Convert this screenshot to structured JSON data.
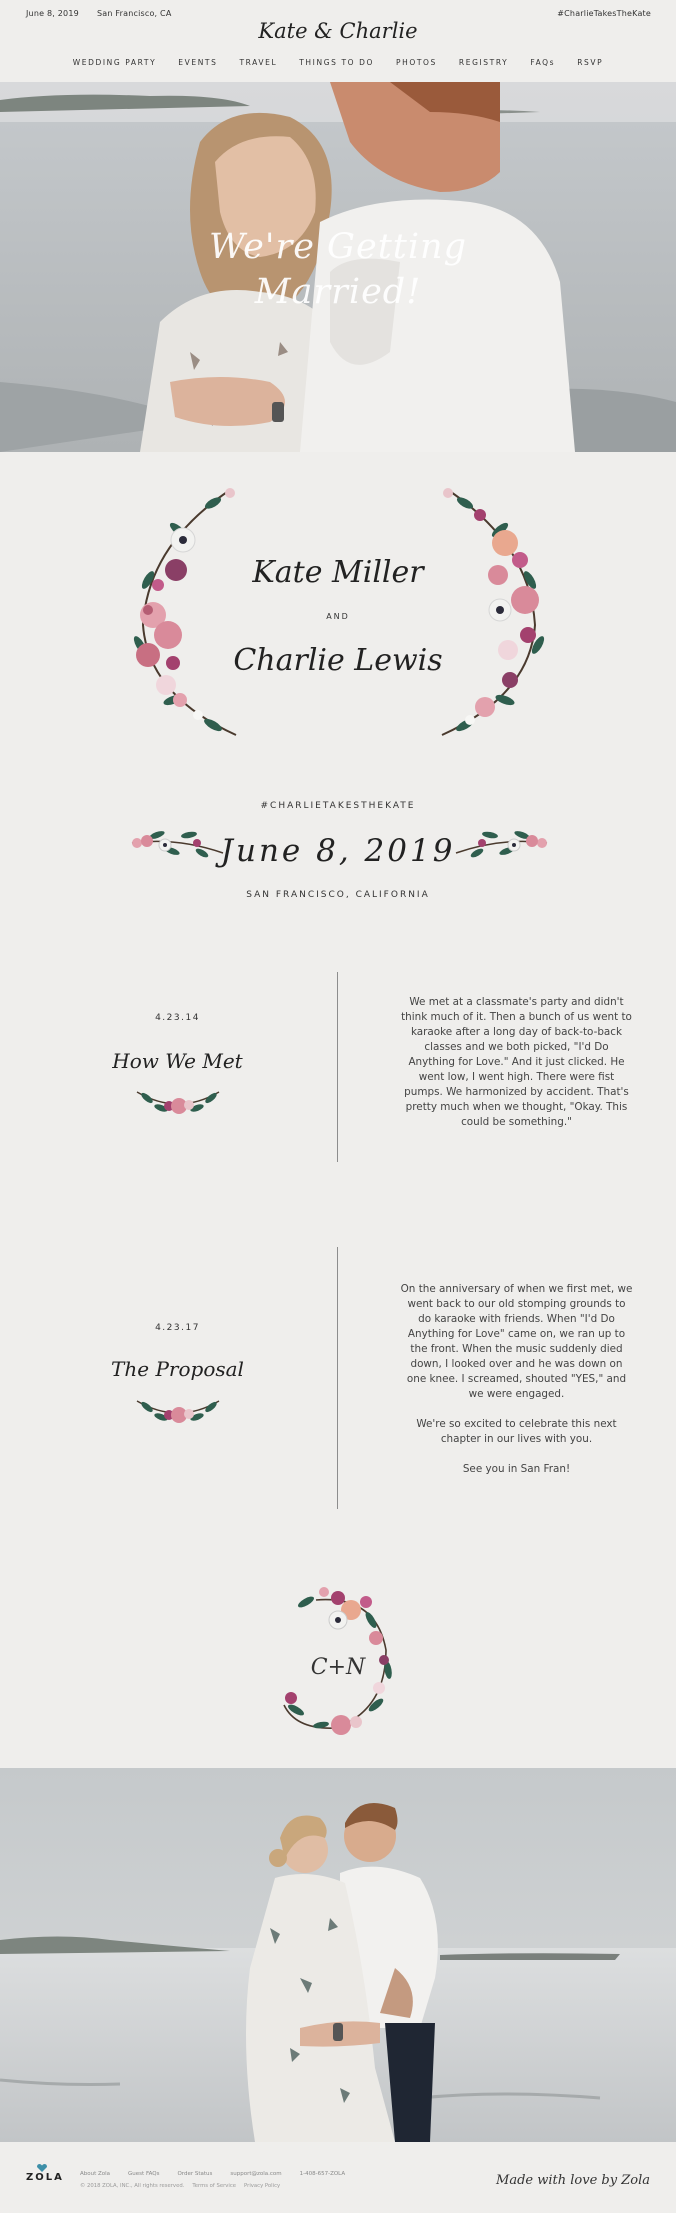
{
  "header": {
    "date": "June 8, 2019",
    "location": "San Francisco, CA",
    "title": "Kate & Charlie",
    "hashtag": "#CharlieTakesTheKate",
    "nav": [
      "WEDDING PARTY",
      "EVENTS",
      "TRAVEL",
      "THINGS TO DO",
      "PHOTOS",
      "REGISTRY",
      "FAQs",
      "RSVP"
    ]
  },
  "hero": {
    "line1": "We're Getting",
    "line2": "Married!"
  },
  "couple": {
    "name1": "Kate Miller",
    "and": "AND",
    "name2": "Charlie Lewis"
  },
  "event": {
    "hashtag": "#CHARLIETAKESTHEKATE",
    "date": "June 8, 2019",
    "city": "SAN FRANCISCO, CALIFORNIA"
  },
  "stories": [
    {
      "date": "4.23.14",
      "title": "How We Met",
      "paragraphs": [
        "We met at a classmate's party and didn't think much of it. Then a bunch of us went to karaoke after a long day of back-to-back classes and we both picked, \"I'd Do Anything for Love.\" And it just clicked. He went low, I went high. There were fist pumps. We harmonized by accident. That's pretty much when we thought, \"Okay. This could be something.\""
      ]
    },
    {
      "date": "4.23.17",
      "title": "The Proposal",
      "paragraphs": [
        "On the anniversary of when we first met, we went back to our old stomping grounds to do karaoke with friends. When \"I'd Do Anything for Love\" came on, we ran up to the front. When the music suddenly died down, I looked over and he was down on one knee. I screamed, shouted \"YES,\" and we were engaged.",
        "We're so excited to celebrate this next chapter in our lives with you.",
        "See you in San Fran!"
      ]
    }
  ],
  "monogram": "C+N",
  "footer": {
    "logo": "ZOLA",
    "links": [
      "About Zola",
      "Guest FAQs",
      "Order Status",
      "support@zola.com",
      "1-408-657-ZOLA"
    ],
    "legal": [
      "© 2018 ZOLA, INC., All rights reserved.",
      "Terms of Service",
      "Privacy Policy"
    ],
    "made_with": "Made with love by Zola"
  },
  "colors": {
    "background": "#efeeec",
    "text": "#333333",
    "divider": "#8d8d8d",
    "flower_pink": "#d98a9a",
    "flower_magenta": "#a3416e",
    "leaf_green": "#2f5e4e",
    "zola_teal": "#3d8fa8"
  }
}
